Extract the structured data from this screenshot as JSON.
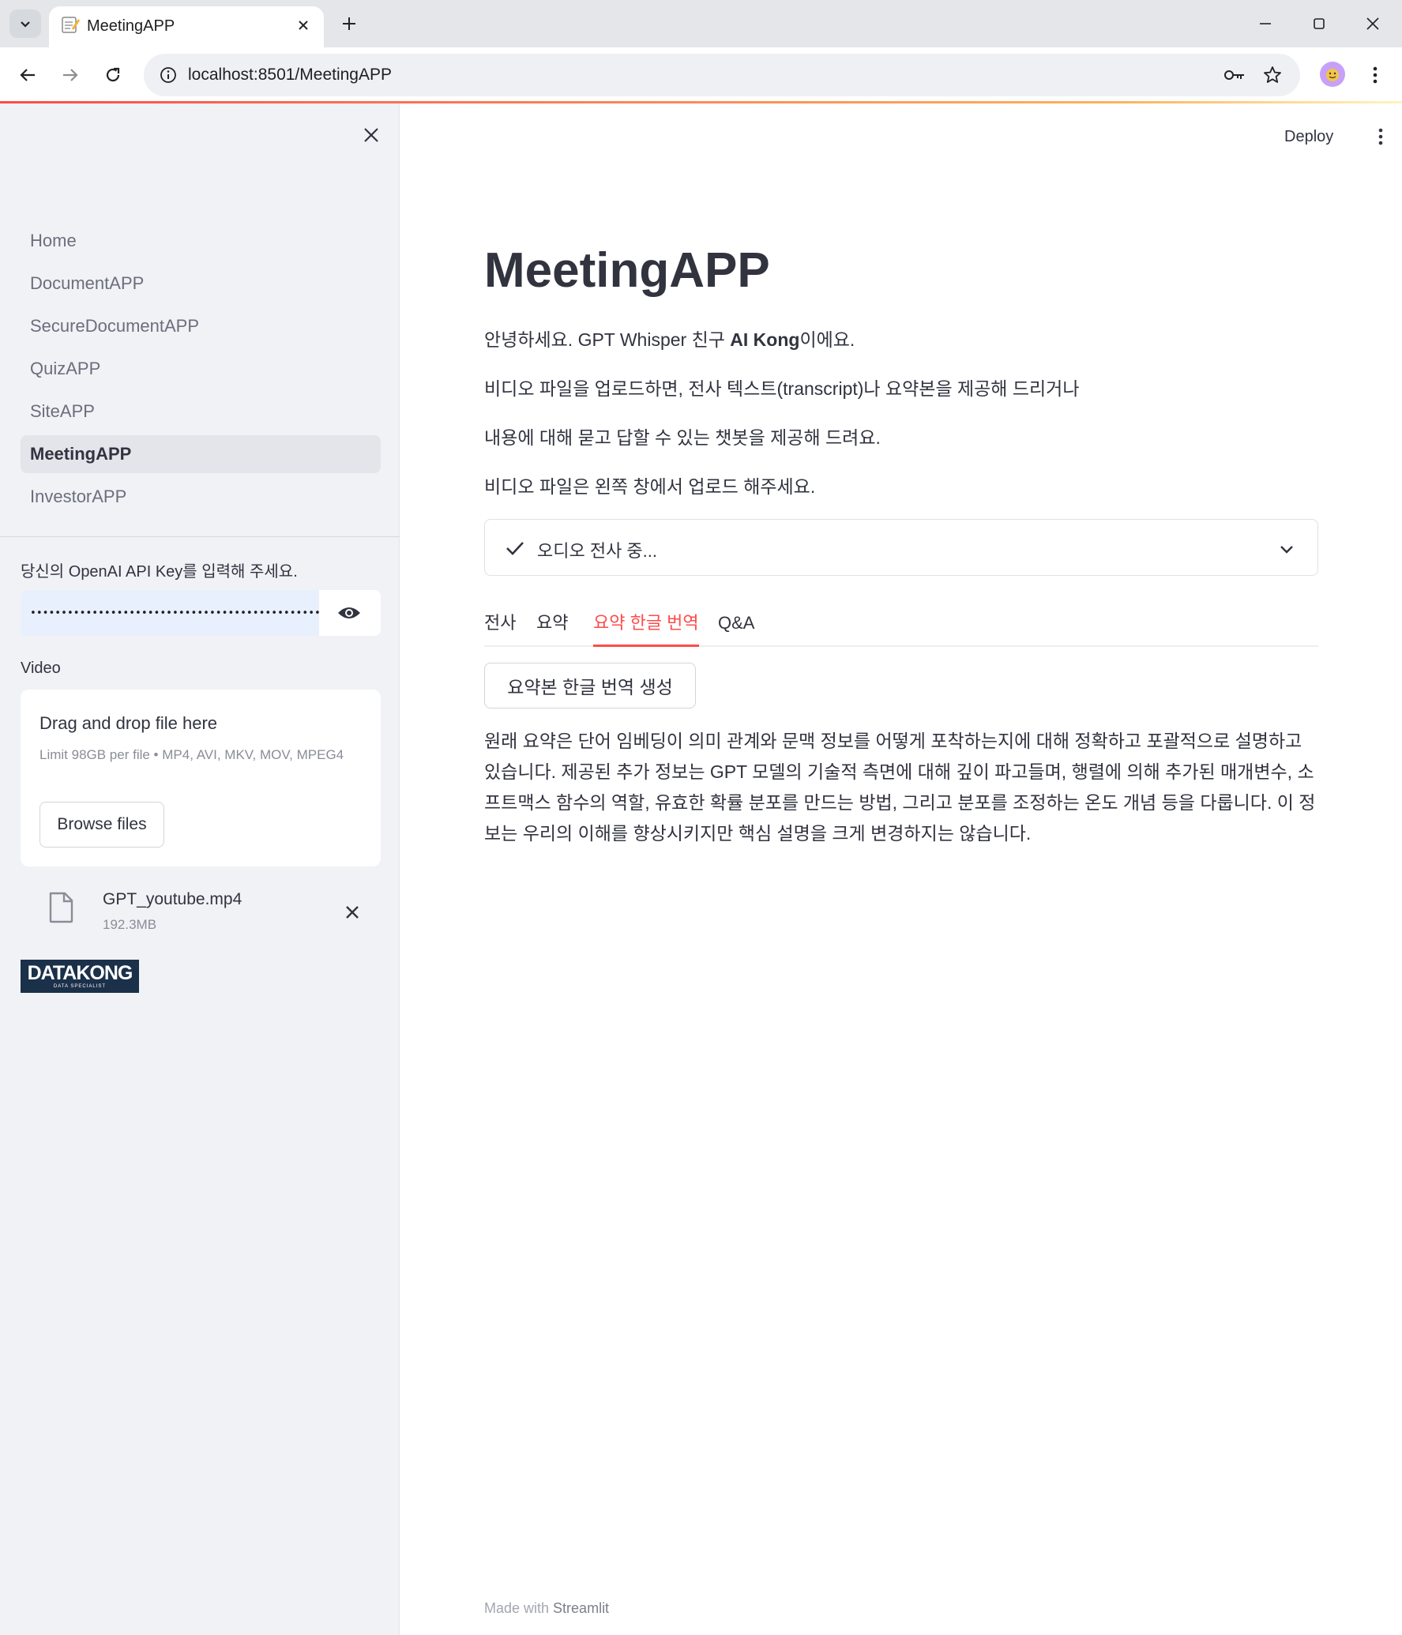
{
  "browser": {
    "tab_title": "MeetingAPP",
    "url": "localhost:8501/MeetingAPP"
  },
  "sidebar": {
    "nav": [
      "Home",
      "DocumentAPP",
      "SecureDocumentAPP",
      "QuizAPP",
      "SiteAPP",
      "MeetingAPP",
      "InvestorAPP"
    ],
    "active_nav": "MeetingAPP",
    "api_key_label": "당신의 OpenAI API Key를 입력해 주세요.",
    "api_key_value": "•••••••••••••••••••••••••••••••••••••••••••••••••••",
    "video_label": "Video",
    "uploader": {
      "title": "Drag and drop file here",
      "limit": "Limit 98GB per file • MP4, AVI, MKV, MOV, MPEG4",
      "browse_label": "Browse files"
    },
    "file": {
      "name": "GPT_youtube.mp4",
      "size": "192.3MB"
    },
    "logo": {
      "main": "DATAKONG",
      "sub": "DATA SPECIALIST"
    }
  },
  "header": {
    "deploy_label": "Deploy"
  },
  "main": {
    "title": "MeetingAPP",
    "intro": {
      "line1_prefix": "안녕하세요. GPT Whisper 친구 ",
      "line1_bold": "AI Kong",
      "line1_suffix": "이에요.",
      "line2": "비디오 파일을 업로드하면, 전사 텍스트(transcript)나 요약본을 제공해 드리거나",
      "line3": "내용에 대해 묻고 답할 수 있는 챗봇을 제공해 드려요.",
      "line4": "비디오 파일은 왼쪽 창에서 업로드 해주세요."
    },
    "status": "오디오 전사 중...",
    "tabs": [
      "전사",
      "요약",
      "요약 한글 번역",
      "Q&A"
    ],
    "active_tab": "요약 한글 번역",
    "generate_button": "요약본 한글 번역 생성",
    "result_text": "원래 요약은 단어 임베딩이 의미 관계와 문맥 정보를 어떻게 포착하는지에 대해 정확하고 포괄적으로 설명하고 있습니다. 제공된 추가 정보는 GPT 모델의 기술적 측면에 대해 깊이 파고들며, 행렬에 의해 추가된 매개변수, 소프트맥스 함수의 역할, 유효한 확률 분포를 만드는 방법, 그리고 분포를 조정하는 온도 개념 등을 다룹니다. 이 정보는 우리의 이해를 향상시키지만 핵심 설명을 크게 변경하지는 않습니다.",
    "footer_prefix": "Made with ",
    "footer_brand": "Streamlit"
  },
  "colors": {
    "accent": "#ff4b4b",
    "sidebar_bg": "#f0f2f6",
    "text": "#31333f"
  },
  "icons": [
    "tab-list-icon",
    "notepad-favicon-icon",
    "close-icon",
    "plus-icon",
    "minimize-icon",
    "maximize-icon",
    "back-icon",
    "forward-icon",
    "reload-icon",
    "site-info-icon",
    "key-icon",
    "star-icon",
    "profile-icon",
    "more-vert-icon",
    "eye-icon",
    "file-icon",
    "check-icon",
    "chevron-down-icon"
  ]
}
